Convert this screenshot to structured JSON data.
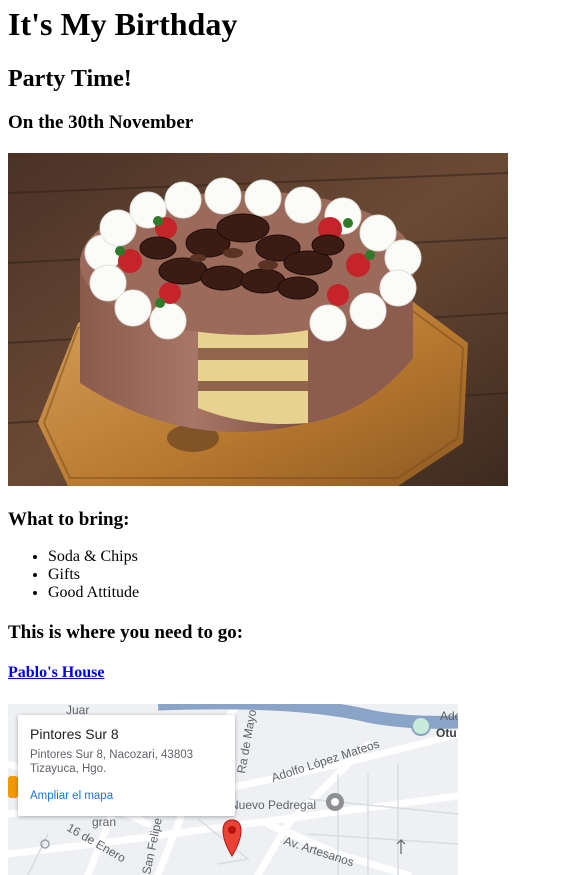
{
  "page": {
    "title": "It's My Birthday",
    "subtitle": "Party Time!",
    "date_line": "On the 30th November"
  },
  "cake_image": {
    "icon": "birthday-cake-photo"
  },
  "bring": {
    "heading": "What to bring:",
    "items": [
      "Soda & Chips",
      "Gifts",
      "Good Attitude"
    ]
  },
  "location": {
    "heading": "This is where you need to go:",
    "link_text": "Pablo's House"
  },
  "map": {
    "place_name": "Pintores Sur 8",
    "address": "Pintores Sur 8, Nacozari, 43803 Tizayuca, Hgo.",
    "bigger_map_link": "Ampliar el mapa",
    "street_labels": [
      "Adolfo López Mateos",
      "Nuevo Pedregal",
      "Av. Artesanos",
      "16 de Enero",
      "San Felipe",
      "Ra de Mayo",
      "Ade",
      "Otu",
      "Juar",
      "gran"
    ],
    "colors": {
      "marker": "#ea4335",
      "link": "#1a73e8",
      "highway": "#8aa4c8"
    }
  }
}
